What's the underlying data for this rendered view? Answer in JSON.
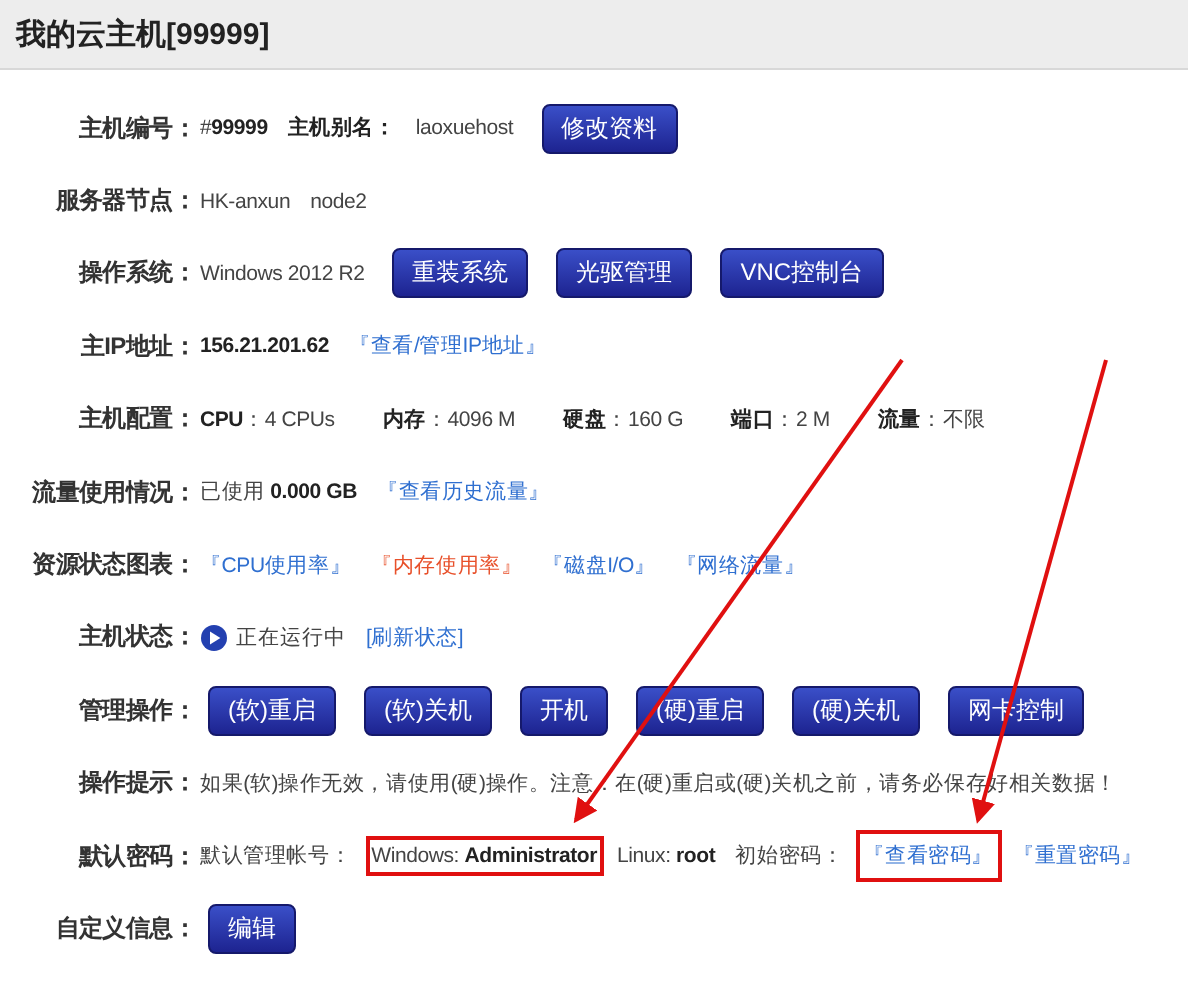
{
  "title": "我的云主机[99999]",
  "rows": [
    {
      "label": "主机编号：",
      "items": [
        {
          "kind": "text",
          "text": "#**99999**"
        },
        {
          "kind": "text",
          "text": "**主机别名：**"
        },
        {
          "kind": "text",
          "text": "laoxuehost"
        },
        {
          "kind": "button",
          "text": "修改资料"
        }
      ]
    },
    {
      "label": "服务器节点：",
      "items": [
        {
          "kind": "text",
          "text": "HK-anxun"
        },
        {
          "kind": "text",
          "text": "node2"
        }
      ]
    },
    {
      "label": "操作系统：",
      "items": [
        {
          "kind": "text",
          "text": "Windows 2012 R2"
        },
        {
          "kind": "button",
          "text": "重装系统"
        },
        {
          "kind": "button",
          "text": "光驱管理"
        },
        {
          "kind": "button",
          "text": "VNC控制台"
        }
      ]
    },
    {
      "label": "主IP地址：",
      "items": [
        {
          "kind": "text",
          "text": "**156.21.201.62**"
        },
        {
          "kind": "link",
          "text": "『查看/管理IP地址』",
          "color": "#2f6fd0"
        }
      ]
    },
    {
      "label": "主机配置：",
      "items": [
        {
          "kind": "text",
          "text": "**CPU**：4 CPUs"
        },
        {
          "kind": "text",
          "text": "**内存**：4096 M"
        },
        {
          "kind": "text",
          "text": "**硬盘**：160 G"
        },
        {
          "kind": "text",
          "text": "**端口**：2 M"
        },
        {
          "kind": "text",
          "text": "**流量**：不限"
        }
      ]
    },
    {
      "label": "流量使用情况：",
      "items": [
        {
          "kind": "text",
          "text": "已使用 **0.000 GB**"
        },
        {
          "kind": "link",
          "text": "『查看历史流量』",
          "color": "#2f6fd0"
        }
      ]
    },
    {
      "label": "资源状态图表：",
      "items": [
        {
          "kind": "link",
          "text": "『CPU使用率』",
          "color": "#2f6fd0"
        },
        {
          "kind": "link",
          "text": "『内存使用率』",
          "color": "#e8502a"
        },
        {
          "kind": "link",
          "text": "『磁盘I/O』",
          "color": "#2f6fd0"
        },
        {
          "kind": "link",
          "text": "『网络流量』",
          "color": "#2f6fd0"
        }
      ]
    },
    {
      "label": "主机状态：",
      "items": [
        {
          "kind": "status",
          "text": "正在运行中"
        },
        {
          "kind": "link",
          "text": "[刷新状态]",
          "color": "#2f6fd0"
        }
      ]
    },
    {
      "label": "管理操作：",
      "items": [
        {
          "kind": "button",
          "text": "(软)重启"
        },
        {
          "kind": "button",
          "text": "(软)关机"
        },
        {
          "kind": "button",
          "text": "开机"
        },
        {
          "kind": "button",
          "text": "(硬)重启"
        },
        {
          "kind": "button",
          "text": "(硬)关机"
        },
        {
          "kind": "button",
          "text": "网卡控制"
        }
      ]
    },
    {
      "label": "操作提示：",
      "items": [
        {
          "kind": "text",
          "text": "如果(软)操作无效，请使用(硬)操作。注意：在(硬)重启或(硬)关机之前，请务必保存好相关数据！"
        }
      ]
    },
    {
      "label": "默认密码：",
      "items": [
        {
          "kind": "text",
          "text": "默认管理帐号："
        },
        {
          "kind": "text",
          "text": "Windows: **Administrator**",
          "highlighted": true
        },
        {
          "kind": "text",
          "text": "Linux: **root**"
        },
        {
          "kind": "text",
          "text": "初始密码："
        },
        {
          "kind": "link",
          "text": "『查看密码』",
          "color": "#2f6fd0",
          "highlighted": true
        },
        {
          "kind": "link",
          "text": "『重置密码』",
          "color": "#2f6fd0"
        }
      ]
    },
    {
      "label": "自定义信息：",
      "items": [
        {
          "kind": "button",
          "text": "编辑"
        }
      ]
    }
  ]
}
